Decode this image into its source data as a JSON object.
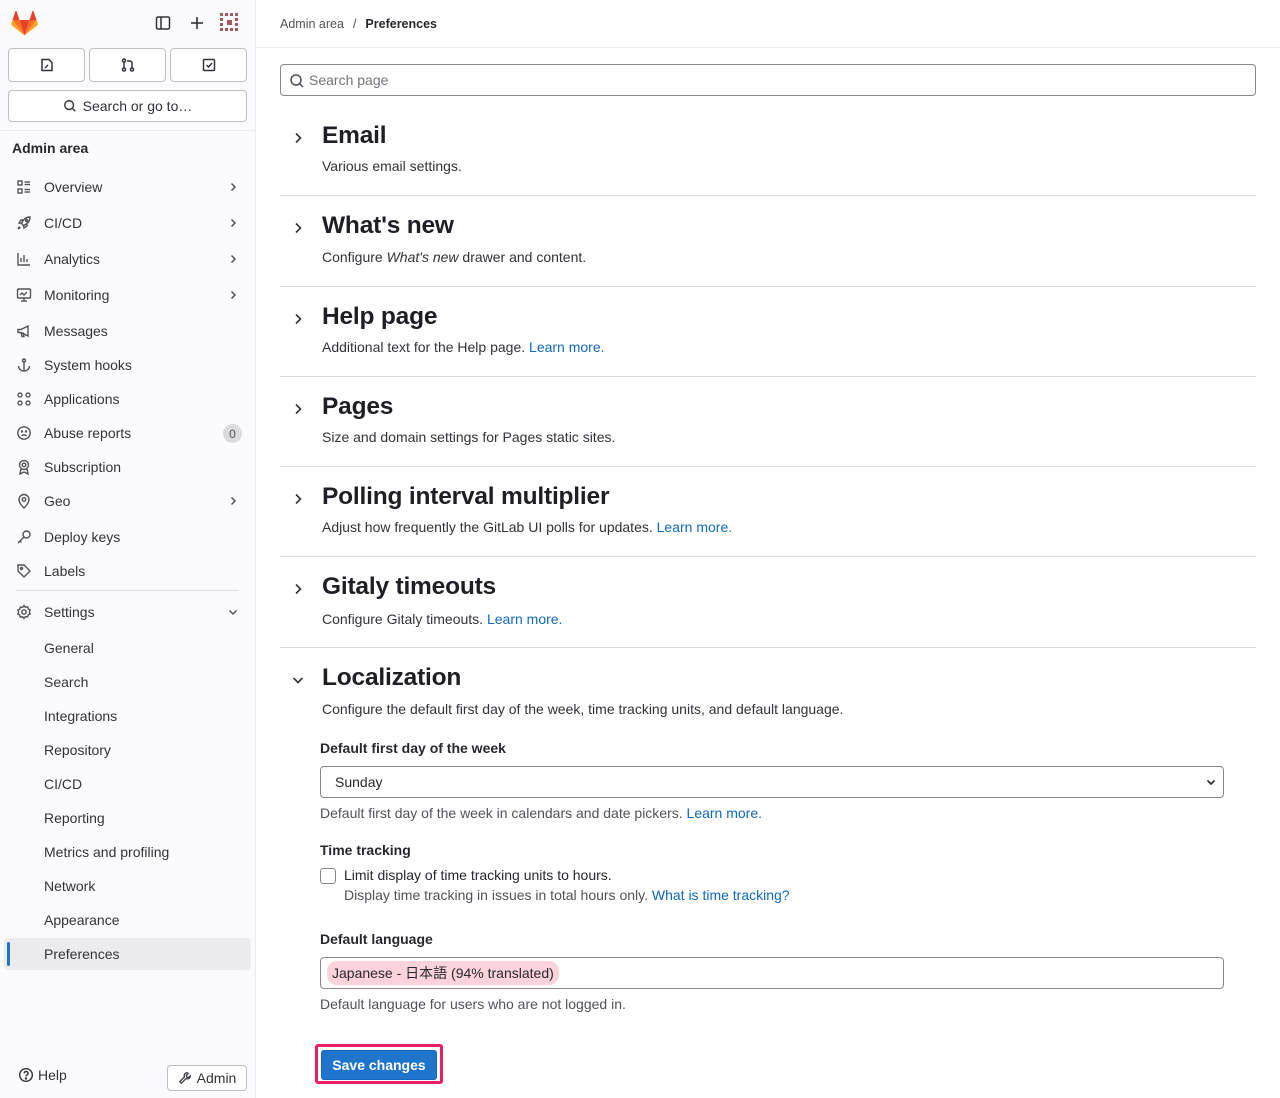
{
  "sidebar": {
    "search_label": "Search or go to…",
    "section_title": "Admin area",
    "nav": [
      {
        "label": "Overview",
        "icon": "overview-icon",
        "chevron": true
      },
      {
        "label": "CI/CD",
        "icon": "rocket-icon",
        "chevron": true
      },
      {
        "label": "Analytics",
        "icon": "chart-icon",
        "chevron": true
      },
      {
        "label": "Monitoring",
        "icon": "monitor-icon",
        "chevron": true
      },
      {
        "label": "Messages",
        "icon": "bullhorn-icon",
        "chevron": false
      },
      {
        "label": "System hooks",
        "icon": "anchor-icon",
        "chevron": false
      },
      {
        "label": "Applications",
        "icon": "applications-icon",
        "chevron": false
      },
      {
        "label": "Abuse reports",
        "icon": "sad-face-icon",
        "badge": "0"
      },
      {
        "label": "Subscription",
        "icon": "license-icon",
        "chevron": false
      },
      {
        "label": "Geo",
        "icon": "location-icon",
        "chevron": true
      },
      {
        "label": "Deploy keys",
        "icon": "key-icon",
        "chevron": false
      },
      {
        "label": "Labels",
        "icon": "label-icon",
        "chevron": false
      }
    ],
    "settings_label": "Settings",
    "settings_sub": [
      "General",
      "Search",
      "Integrations",
      "Repository",
      "CI/CD",
      "Reporting",
      "Metrics and profiling",
      "Network",
      "Appearance",
      "Preferences"
    ],
    "help_label": "Help",
    "admin_label": "Admin"
  },
  "breadcrumb": {
    "parent": "Admin area",
    "separator": "/",
    "current": "Preferences"
  },
  "page_search": {
    "placeholder": "Search page"
  },
  "sections": [
    {
      "title": "Email",
      "desc": "Various email settings."
    },
    {
      "title": "What's new",
      "desc_pre": "Configure ",
      "desc_em": "What's new",
      "desc_post": " drawer and content."
    },
    {
      "title": "Help page",
      "desc": "Additional text for the Help page. ",
      "link": "Learn more."
    },
    {
      "title": "Pages",
      "desc": "Size and domain settings for Pages static sites."
    },
    {
      "title": "Polling interval multiplier",
      "desc": "Adjust how frequently the GitLab UI polls for updates. ",
      "link": "Learn more."
    },
    {
      "title": "Gitaly timeouts",
      "desc": "Configure Gitaly timeouts. ",
      "link": "Learn more."
    },
    {
      "title": "Localization",
      "desc": "Configure the default first day of the week, time tracking units, and default language."
    }
  ],
  "localization": {
    "first_day_label": "Default first day of the week",
    "first_day_value": "Sunday",
    "first_day_help": "Default first day of the week in calendars and date pickers. ",
    "first_day_link": "Learn more.",
    "time_tracking_label": "Time tracking",
    "time_tracking_checkbox": "Limit display of time tracking units to hours.",
    "time_tracking_help": "Display time tracking in issues in total hours only. ",
    "time_tracking_link": "What is time tracking?",
    "language_label": "Default language",
    "language_value": "Japanese - 日本語 (94% translated)",
    "language_help": "Default language for users who are not logged in.",
    "save_label": "Save changes"
  },
  "colors": {
    "accent": "#1f75cb",
    "highlight": "#e91e63",
    "chip": "#fcd3dd",
    "logo": "#e24329"
  }
}
